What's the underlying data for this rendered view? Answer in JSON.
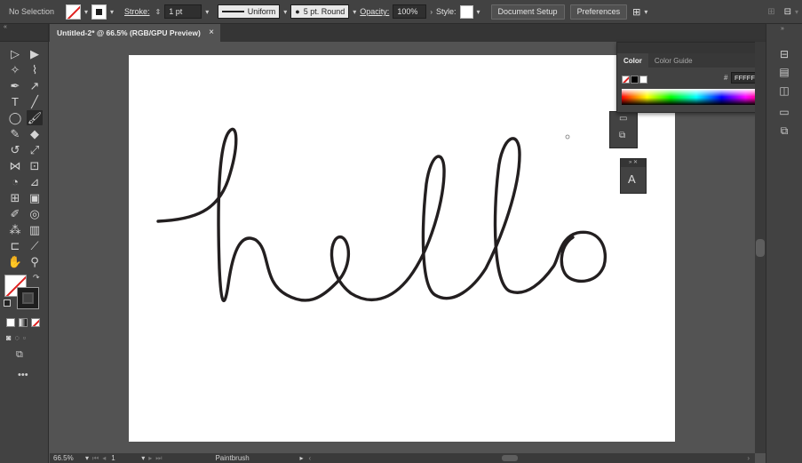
{
  "control_bar": {
    "selection_label": "No Selection",
    "stroke_label": "Stroke:",
    "stroke_weight": "1 pt",
    "profile_label": "Uniform",
    "brush_label": "5 pt. Round",
    "opacity_label": "Opacity:",
    "opacity_value": "100%",
    "style_label": "Style:",
    "document_setup_label": "Document Setup",
    "preferences_label": "Preferences"
  },
  "document_tab": {
    "title": "Untitled-2* @ 66.5% (RGB/GPU Preview)",
    "close": "×"
  },
  "color_panel": {
    "tab_color": "Color",
    "tab_color_guide": "Color Guide",
    "hex_label": "#",
    "hex_value": "FFFFFF"
  },
  "artwork": {
    "text": "hello",
    "stroke_color": "#231f20"
  },
  "status_bar": {
    "zoom": "66.5%",
    "artboard_number": "1",
    "current_tool": "Paintbrush"
  },
  "colors": {
    "app_bg": "#535353",
    "panel_bg": "#424242",
    "artboard": "#ffffff"
  }
}
